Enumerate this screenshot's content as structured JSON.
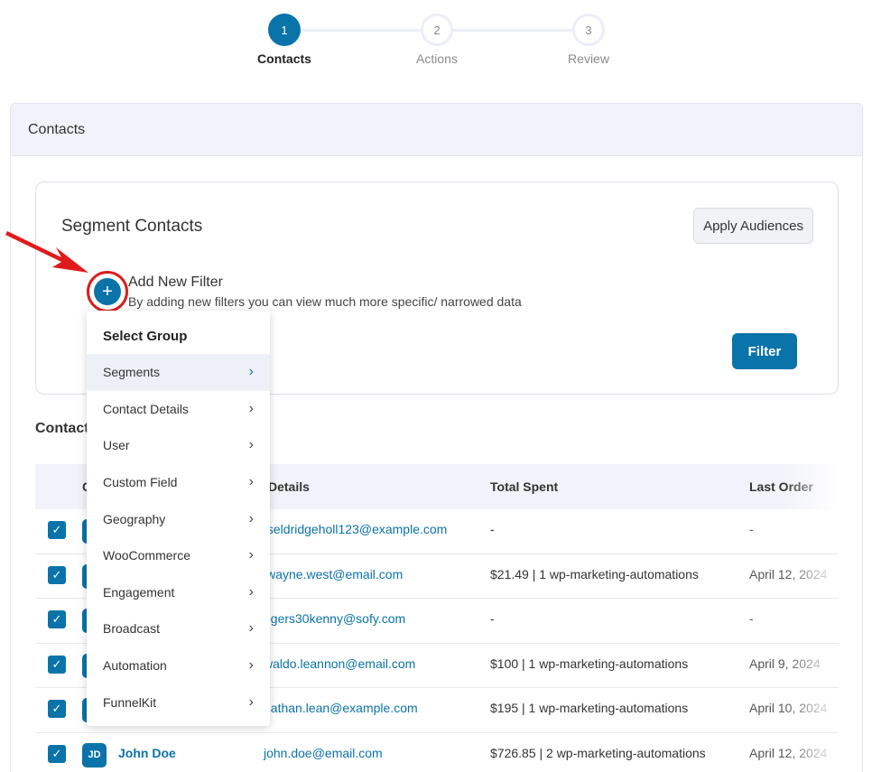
{
  "stepper": {
    "steps": [
      {
        "number": "1",
        "label": "Contacts"
      },
      {
        "number": "2",
        "label": "Actions"
      },
      {
        "number": "3",
        "label": "Review"
      }
    ]
  },
  "card": {
    "title": "Contacts"
  },
  "segment": {
    "title": "Segment Contacts",
    "apply_label": "Apply Audiences",
    "add_filter_icon": "+",
    "add_filter_title": "Add New Filter",
    "add_filter_desc": "By adding new filters you can view much more specific/ narrowed data",
    "filter_label": "Filter"
  },
  "contacts_section": {
    "label": "Contacts"
  },
  "table": {
    "columns": [
      "C",
      "Details",
      "Total Spent",
      "Last Order"
    ],
    "rows": [
      {
        "initials": "",
        "name": "",
        "email": "tseldridgeholl123@example.com",
        "spent": "-",
        "order": "-"
      },
      {
        "initials": "",
        "name": "",
        "email": "lwayne.west@email.com",
        "spent": "$21.49 | 1 wp-marketing-automations",
        "order": "April 12, 2024"
      },
      {
        "initials": "",
        "name": "",
        "email": "ogers30kenny@sofy.com",
        "spent": "-",
        "order": "-"
      },
      {
        "initials": "",
        "name": "",
        "email": "waldo.leannon@email.com",
        "spent": "$100 | 1 wp-marketing-automations",
        "order": "April 9, 2024"
      },
      {
        "initials": "",
        "name": "",
        "email": "nathan.lean@example.com",
        "spent": "$195 | 1 wp-marketing-automations",
        "order": "April 10, 2024"
      },
      {
        "initials": "JD",
        "name": "John Doe",
        "email": "john.doe@email.com",
        "spent": "$726.85 | 2 wp-marketing-automations",
        "order": "April 12, 2024"
      }
    ]
  },
  "dropdown": {
    "title": "Select Group",
    "items": [
      "Segments",
      "Contact Details",
      "User",
      "Custom Field",
      "Geography",
      "WooCommerce",
      "Engagement",
      "Broadcast",
      "Automation",
      "FunnelKit"
    ],
    "chevron": "›"
  },
  "colors": {
    "primary": "#0a73aa",
    "highlight": "#d91e1e"
  }
}
